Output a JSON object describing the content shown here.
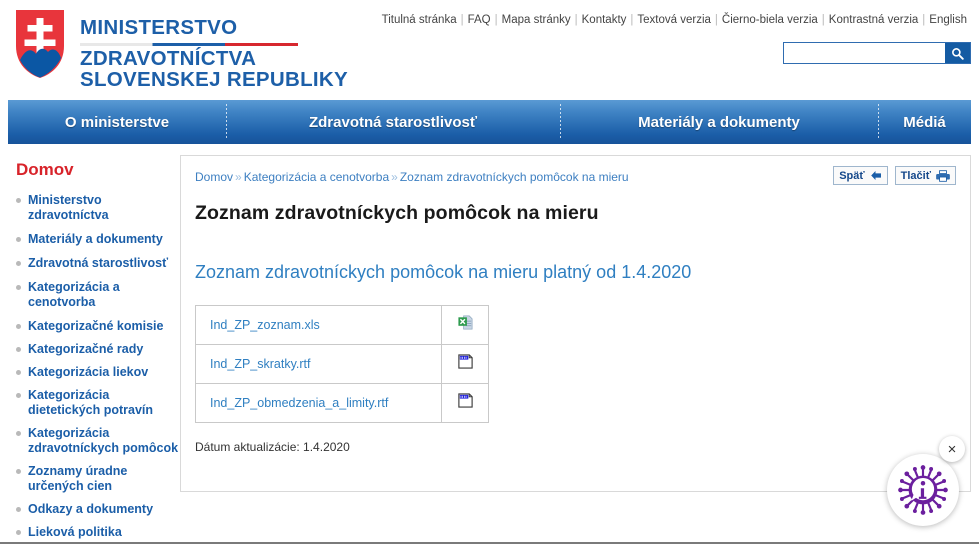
{
  "header": {
    "ministry_line1": "MINISTERSTVO",
    "ministry_line2": "ZDRAVOTNÍCTVA",
    "ministry_line3": "SLOVENSKEJ REPUBLIKY",
    "emblem_name": "slovak-coat-of-arms",
    "toplinks": [
      "Titulná stránka",
      "FAQ",
      "Mapa stránky",
      "Kontakty",
      "Textová verzia",
      "Čierno-biela verzia",
      "Kontrastná verzia",
      "English"
    ],
    "search": {
      "value": "",
      "placeholder": "",
      "icon": "search-icon"
    }
  },
  "mainnav": [
    {
      "label": "O ministerstve"
    },
    {
      "label": "Zdravotná starostlivosť"
    },
    {
      "label": "Materiály a dokumenty"
    },
    {
      "label": "Médiá"
    }
  ],
  "sidebar": {
    "title": "Domov",
    "items": [
      {
        "label": "Ministerstvo zdravotníctva"
      },
      {
        "label": "Materiály a dokumenty"
      },
      {
        "label": "Zdravotná starostlivosť"
      },
      {
        "label": "Kategorizácia a cenotvorba"
      }
    ],
    "subitems": [
      {
        "label": "Kategorizačné komisie"
      },
      {
        "label": "Kategorizačné rady"
      },
      {
        "label": "Kategorizácia liekov"
      },
      {
        "label": "Kategorizácia dietetických potravín"
      },
      {
        "label": "Kategorizácia zdravotníckych pomôcok"
      },
      {
        "label": "Zoznamy úradne určených cien"
      },
      {
        "label": "Odkazy a dokumenty"
      },
      {
        "label": "Lieková politika"
      }
    ]
  },
  "content": {
    "breadcrumb": [
      "Domov",
      "Kategorizácia a cenotvorba",
      "Zoznam zdravotníckych pomôcok na mieru"
    ],
    "breadcrumb_separator": "»",
    "buttons": {
      "back_label": "Späť",
      "back_icon": "arrow-left-icon",
      "print_label": "Tlačiť",
      "print_icon": "printer-icon"
    },
    "page_title": "Zoznam zdravotníckych pomôcok na mieru",
    "sub_title": "Zoznam zdravotníckych pomôcok na mieru platný od 1.4.2020",
    "files": [
      {
        "name": "Ind_ZP_zoznam.xls",
        "icon": "excel-file-icon"
      },
      {
        "name": "Ind_ZP_skratky.rtf",
        "icon": "rtf-file-icon"
      },
      {
        "name": "Ind_ZP_obmedzenia_a_limity.rtf",
        "icon": "rtf-file-icon"
      }
    ],
    "updated": "Dátum aktualizácie: 1.4.2020"
  },
  "widget": {
    "icon": "covid-info-icon",
    "close_label": "×"
  },
  "colors": {
    "brand_blue": "#1b5ea8",
    "accent_red": "#d8232a",
    "link_blue": "#2f7fc1",
    "widget_purple": "#6b1f9e"
  }
}
